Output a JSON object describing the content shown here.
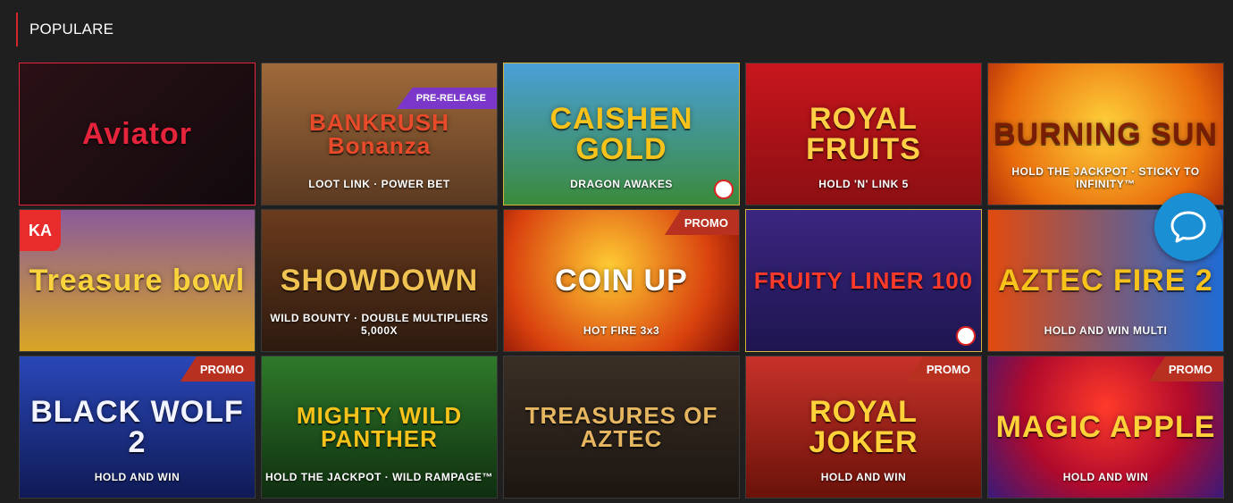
{
  "section": {
    "title": "POPULARE"
  },
  "games": [
    {
      "name": "Aviator",
      "sub": "",
      "badge": "",
      "bg": "linear-gradient(135deg,#2a1116,#120a0d)",
      "color": "#e5243b",
      "border": "#e5243b"
    },
    {
      "name": "BANKRUSH Bonanza",
      "sub": "LOOT LINK · POWER BET",
      "badge": "PRE-RELEASE",
      "bg": "linear-gradient(180deg,#a06a3a,#5b3a22)",
      "color": "#e84a2a"
    },
    {
      "name": "CAISHEN GOLD",
      "sub": "DRAGON AWAKES",
      "badge": "",
      "bg": "linear-gradient(180deg,#4aa0d8,#3b8a3c)",
      "color": "#f7c21a",
      "chip": true,
      "border": "#d6b33a"
    },
    {
      "name": "ROYAL FRUITS",
      "sub": "HOLD 'N' LINK 5",
      "badge": "",
      "bg": "linear-gradient(180deg,#c8161d,#8b0f12)",
      "color": "#ffd046"
    },
    {
      "name": "BURNING SUN",
      "sub": "HOLD THE JACKPOT · STICKY TO INFINITY™",
      "badge": "",
      "bg": "radial-gradient(circle at 50% 45%,#ffd23a,#e86a0b 70%,#b3300a)",
      "color": "#7a1d05"
    },
    {
      "name": "Treasure bowl",
      "sub": "",
      "badge": "",
      "bg": "linear-gradient(180deg,#8a5a9a,#d9a524)",
      "color": "#f9d23d",
      "ka": "KA"
    },
    {
      "name": "SHOWDOWN",
      "sub": "WILD BOUNTY · DOUBLE MULTIPLIERS 5,000X",
      "badge": "",
      "bg": "linear-gradient(180deg,#6b3b1d,#2d1a0f)",
      "color": "#f0c251"
    },
    {
      "name": "COIN UP",
      "sub": "HOT FIRE 3x3",
      "badge": "PROMO",
      "bg": "radial-gradient(circle at 45% 40%,#ffcc33,#d9420e 65%,#7a0b06)",
      "color": "#ffffff"
    },
    {
      "name": "FRUITY LINER 100",
      "sub": "",
      "badge": "",
      "bg": "linear-gradient(180deg,#3b2680,#1e1550)",
      "color": "#ff3a2a",
      "chip": true,
      "border": "#d6b33a"
    },
    {
      "name": "AZTEC FIRE 2",
      "sub": "HOLD AND WIN MULTI",
      "badge": "",
      "bg": "linear-gradient(90deg,#e24a0e,#1e6bd6)",
      "color": "#f7c21a"
    },
    {
      "name": "BLACK WOLF 2",
      "sub": "HOLD AND WIN",
      "badge": "PROMO",
      "bg": "linear-gradient(180deg,#2a47b8,#0f1a55)",
      "color": "#f2f4ff"
    },
    {
      "name": "MIGHTY WILD PANTHER",
      "sub": "HOLD THE JACKPOT · WILD RAMPAGE™",
      "badge": "",
      "bg": "linear-gradient(180deg,#2f7a2a,#0f2e10)",
      "color": "#f7c21a"
    },
    {
      "name": "TREASURES OF AZTEC",
      "sub": "",
      "badge": "",
      "bg": "linear-gradient(180deg,#3a2e24,#1c1612)",
      "color": "#e6b660"
    },
    {
      "name": "ROYAL JOKER",
      "sub": "HOLD AND WIN",
      "badge": "PROMO",
      "bg": "linear-gradient(180deg,#c8322a,#6a1209)",
      "color": "#ffd23a"
    },
    {
      "name": "MAGIC APPLE",
      "sub": "HOLD AND WIN",
      "badge": "PROMO",
      "bg": "radial-gradient(circle at 50% 35%,#ff3a2a,#b00a2c 55%,#3a1a7a)",
      "color": "#ffd23a"
    }
  ],
  "chat": {
    "icon": "chat-bubble-icon",
    "color": "#1a8fd3"
  }
}
